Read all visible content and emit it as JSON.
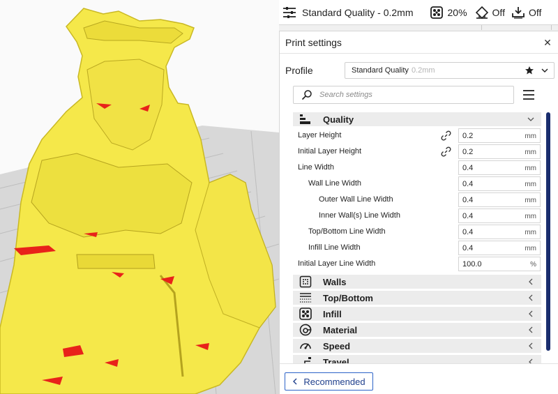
{
  "toolbar": {
    "profile_label": "Standard Quality - 0.2mm",
    "infill_label": "20%",
    "support_label": "Off",
    "adhesion_label": "Off",
    "icons": [
      "print-settings-icon",
      "infill-icon",
      "support-icon",
      "adhesion-icon"
    ]
  },
  "panel": {
    "title": "Print settings",
    "close_icon": "close-icon",
    "profile": {
      "label": "Profile",
      "value": "Standard Quality",
      "sub": "0.2mm"
    },
    "search": {
      "placeholder": "Search settings",
      "value": ""
    },
    "categories_open": {
      "name": "Quality",
      "icon": "quality-icon"
    },
    "settings": [
      {
        "label": "Layer Height",
        "value": "0.2",
        "unit": "mm",
        "linked": true,
        "indent": 0
      },
      {
        "label": "Initial Layer Height",
        "value": "0.2",
        "unit": "mm",
        "linked": true,
        "indent": 0
      },
      {
        "label": "Line Width",
        "value": "0.4",
        "unit": "mm",
        "linked": false,
        "indent": 0
      },
      {
        "label": "Wall Line Width",
        "value": "0.4",
        "unit": "mm",
        "linked": false,
        "indent": 1
      },
      {
        "label": "Outer Wall Line Width",
        "value": "0.4",
        "unit": "mm",
        "linked": false,
        "indent": 2
      },
      {
        "label": "Inner Wall(s) Line Width",
        "value": "0.4",
        "unit": "mm",
        "linked": false,
        "indent": 2
      },
      {
        "label": "Top/Bottom Line Width",
        "value": "0.4",
        "unit": "mm",
        "linked": false,
        "indent": 1
      },
      {
        "label": "Infill Line Width",
        "value": "0.4",
        "unit": "mm",
        "linked": false,
        "indent": 1
      },
      {
        "label": "Initial Layer Line Width",
        "value": "100.0",
        "unit": "%",
        "linked": false,
        "indent": 0
      }
    ],
    "categories_closed": [
      {
        "name": "Walls",
        "icon": "walls-icon"
      },
      {
        "name": "Top/Bottom",
        "icon": "top-bottom-icon"
      },
      {
        "name": "Infill",
        "icon": "infill-icon"
      },
      {
        "name": "Material",
        "icon": "material-icon"
      },
      {
        "name": "Speed",
        "icon": "speed-icon"
      },
      {
        "name": "Travel",
        "icon": "travel-icon"
      }
    ],
    "footer": {
      "recommended_label": "Recommended"
    }
  },
  "colors": {
    "model": "#f5e84a",
    "overhang": "#e8221a",
    "accent": "#2c63c8",
    "scrollbar": "#1a2d6e"
  }
}
